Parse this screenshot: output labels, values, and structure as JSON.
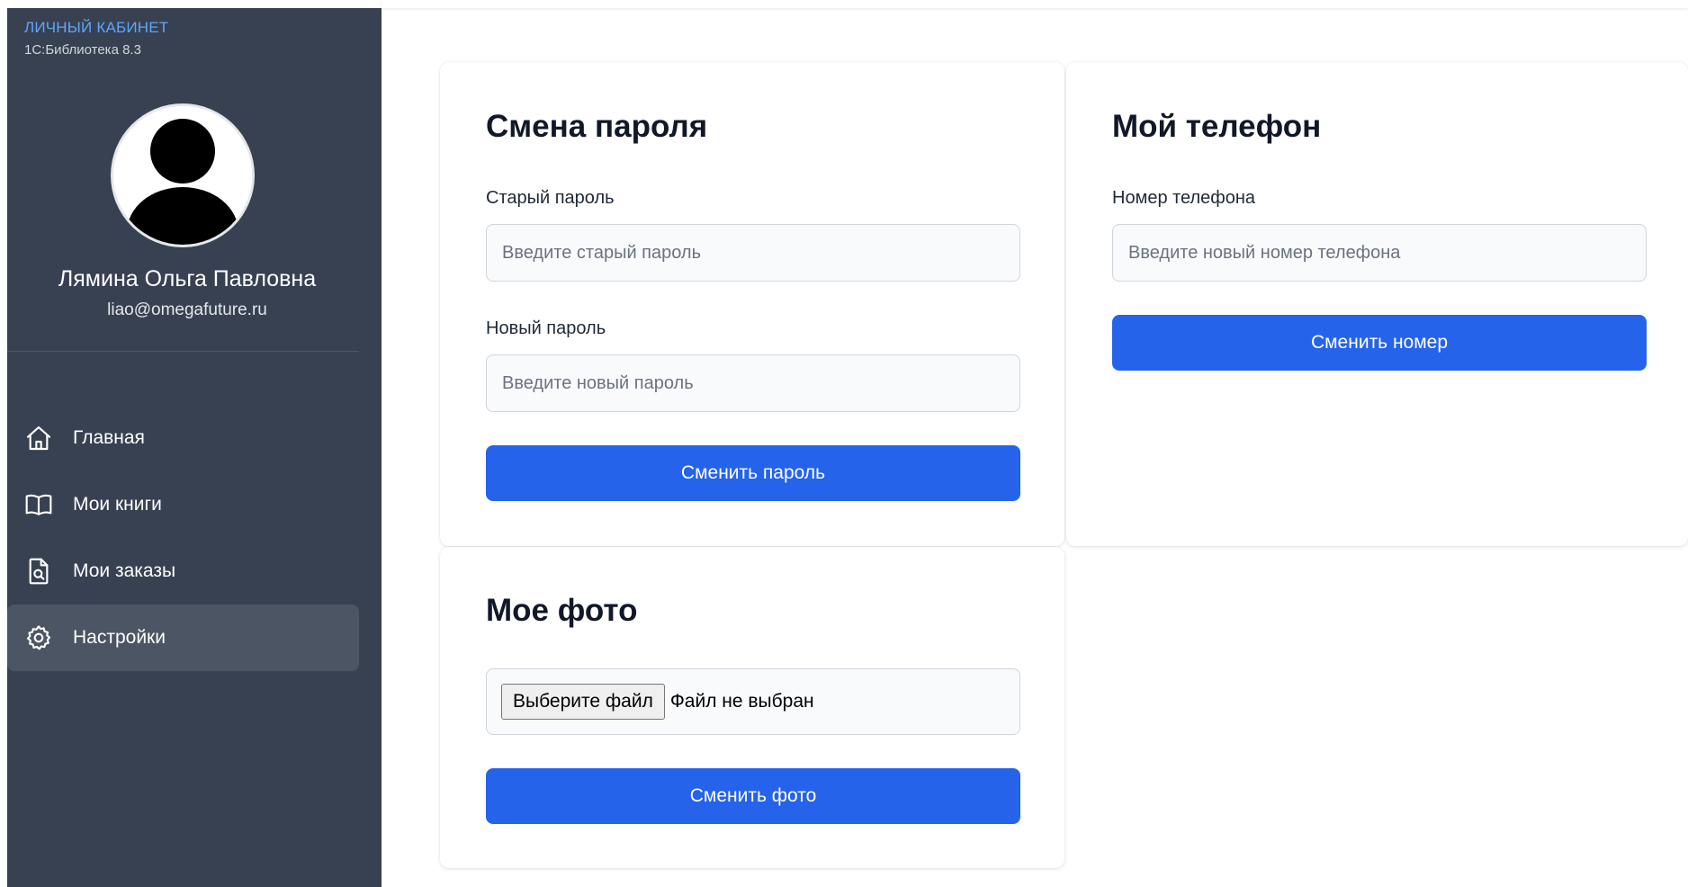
{
  "sidebar": {
    "brand_title": "ЛИЧНЫЙ КАБИНЕТ",
    "brand_subtitle": "1С:Библиотека 8.3",
    "user": {
      "name": "Лямина Ольга Павловна",
      "email": "liao@omegafuture.ru"
    },
    "nav": [
      {
        "label": "Главная",
        "icon": "home-icon",
        "active": false
      },
      {
        "label": "Мои книги",
        "icon": "book-open-icon",
        "active": false
      },
      {
        "label": "Мои заказы",
        "icon": "document-search-icon",
        "active": false
      },
      {
        "label": "Настройки",
        "icon": "gear-icon",
        "active": true
      }
    ]
  },
  "password_card": {
    "title": "Смена пароля",
    "old_label": "Старый пароль",
    "old_placeholder": "Введите старый пароль",
    "new_label": "Новый пароль",
    "new_placeholder": "Введите новый пароль",
    "button": "Сменить пароль"
  },
  "phone_card": {
    "title": "Мой телефон",
    "label": "Номер телефона",
    "placeholder": "Введите новый номер телефона",
    "button": "Сменить номер"
  },
  "photo_card": {
    "title": "Мое фото",
    "file_button": "Выберите файл",
    "file_status": "Файл не выбран",
    "button": "Сменить фото"
  },
  "colors": {
    "sidebar_bg": "#374151",
    "active_item_bg": "#4b5563",
    "brand_accent": "#60a5fa",
    "primary": "#2563eb"
  }
}
